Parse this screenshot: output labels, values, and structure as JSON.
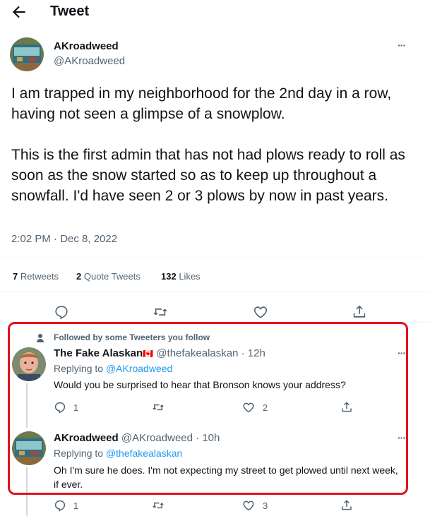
{
  "header": {
    "title": "Tweet"
  },
  "tweet": {
    "display_name": "AKroadweed",
    "handle": "@AKroadweed",
    "paragraph1": "I am trapped in my neighborhood for the 2nd day in a row, having not seen a glimpse of a snowplow.",
    "paragraph2": "This is the first admin that has not had plows ready to roll as soon as the snow started so as to keep up throughout a snowfall. I'd have seen 2 or 3 plows by now in past years.",
    "timestamp": "2:02 PM · Dec 8, 2022",
    "more": "···"
  },
  "stats": {
    "retweets_count": "7",
    "retweets_label": "Retweets",
    "quotes_count": "2",
    "quotes_label": "Quote Tweets",
    "likes_count": "132",
    "likes_label": "Likes"
  },
  "social_context": "Followed by some Tweeters you follow",
  "replies": [
    {
      "display_name": "The Fake Alaskan",
      "flag": "🇨🇦",
      "handle_time": "@thefakealaskan · 12h",
      "replying_prefix": "Replying to",
      "replying_to": "@AKroadweed",
      "text": "Would you be surprised to hear that Bronson knows your address?",
      "reply_count": "1",
      "retweet_count": "",
      "like_count": "2",
      "more": "···"
    },
    {
      "display_name": "AKroadweed",
      "handle_time": "@AKroadweed · 10h",
      "replying_prefix": "Replying to",
      "replying_to": "@thefakealaskan",
      "text": "Oh I'm sure he does. I'm not expecting my street to get plowed until next week, if ever.",
      "reply_count": "1",
      "retweet_count": "",
      "like_count": "3",
      "more": "···"
    }
  ],
  "colors": {
    "accent": "#1d9bf0",
    "highlight_border": "#e0141e",
    "muted": "#536471"
  },
  "icons": [
    "back-arrow-icon",
    "more-icon",
    "reply-icon",
    "retweet-icon",
    "like-icon",
    "share-icon",
    "person-icon"
  ]
}
